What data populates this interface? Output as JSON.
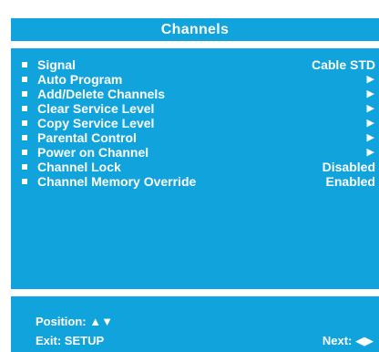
{
  "title": "Channels",
  "menu": {
    "items": [
      {
        "label": "Signal",
        "value": "Cable STD"
      },
      {
        "label": "Auto Program",
        "arrow": "▶"
      },
      {
        "label": "Add/Delete Channels",
        "arrow": "▶"
      },
      {
        "label": "Clear Service Level",
        "arrow": "▶"
      },
      {
        "label": "Copy Service Level",
        "arrow": "▶"
      },
      {
        "label": "Parental Control",
        "arrow": "▶"
      },
      {
        "label": "Power on Channel",
        "arrow": "▶"
      },
      {
        "label": "Channel Lock",
        "value": "Disabled"
      },
      {
        "label": "Channel Memory Override",
        "value": "Enabled"
      }
    ]
  },
  "footer": {
    "position": "Position: ▲▼",
    "exit": "Exit: SETUP",
    "next": "Next: ◀▶"
  },
  "colors": {
    "panel": "#11a4dc",
    "text": "#ffffff",
    "background": "#ffffff"
  }
}
